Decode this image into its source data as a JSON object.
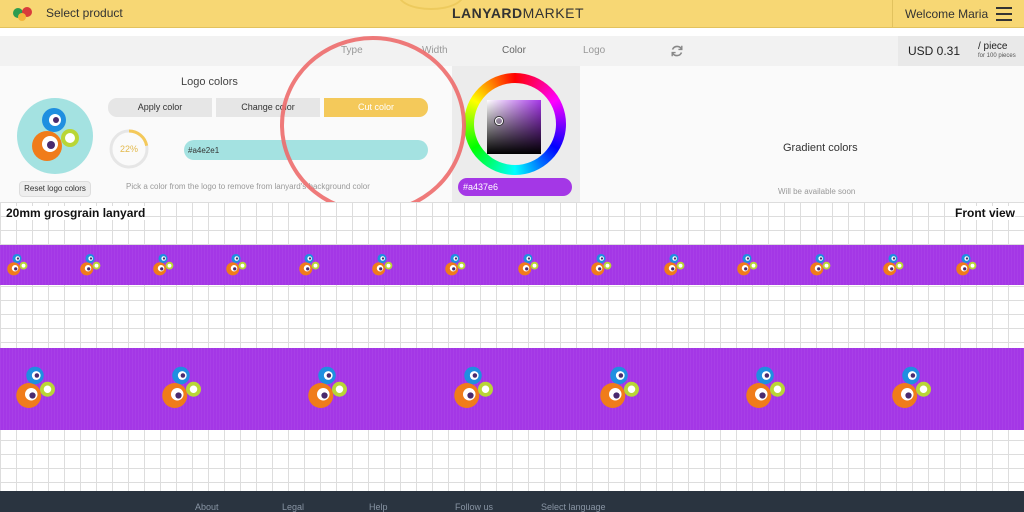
{
  "header": {
    "select_product": "Select product",
    "brand_bold": "LANYARD",
    "brand_light": "MARKET",
    "welcome": "Welcome Maria"
  },
  "tabs": [
    {
      "label": "Type"
    },
    {
      "label": "Width"
    },
    {
      "label": "Color",
      "active": true
    },
    {
      "label": "Logo"
    }
  ],
  "price": {
    "amount": "USD 0.31",
    "per": "/ piece",
    "note": "for 100 pieces"
  },
  "logo_colors": {
    "title": "Logo colors",
    "reset_label": "Reset logo colors",
    "apply_label": "Apply color",
    "change_label": "Change color",
    "cut_label": "Cut color",
    "progress_text": "22%",
    "progress_value": 0.22,
    "hex_value": "#a4e2e1",
    "hint": "Pick a color from the logo to remove from lanyard's background color"
  },
  "picker": {
    "selected_hex": "#a437e6"
  },
  "gradient": {
    "title": "Gradient colors",
    "note": "Will be available soon"
  },
  "preview": {
    "title": "20mm grosgrain lanyard",
    "view": "Front view",
    "strap_color": "#a437e6"
  },
  "footer": {
    "links": [
      "About",
      "Legal",
      "Help",
      "Follow us",
      "Select language"
    ]
  },
  "colors": {
    "accent": "#f7d774",
    "cut_button": "#f4c95a",
    "highlight": "#ed6b6b"
  }
}
